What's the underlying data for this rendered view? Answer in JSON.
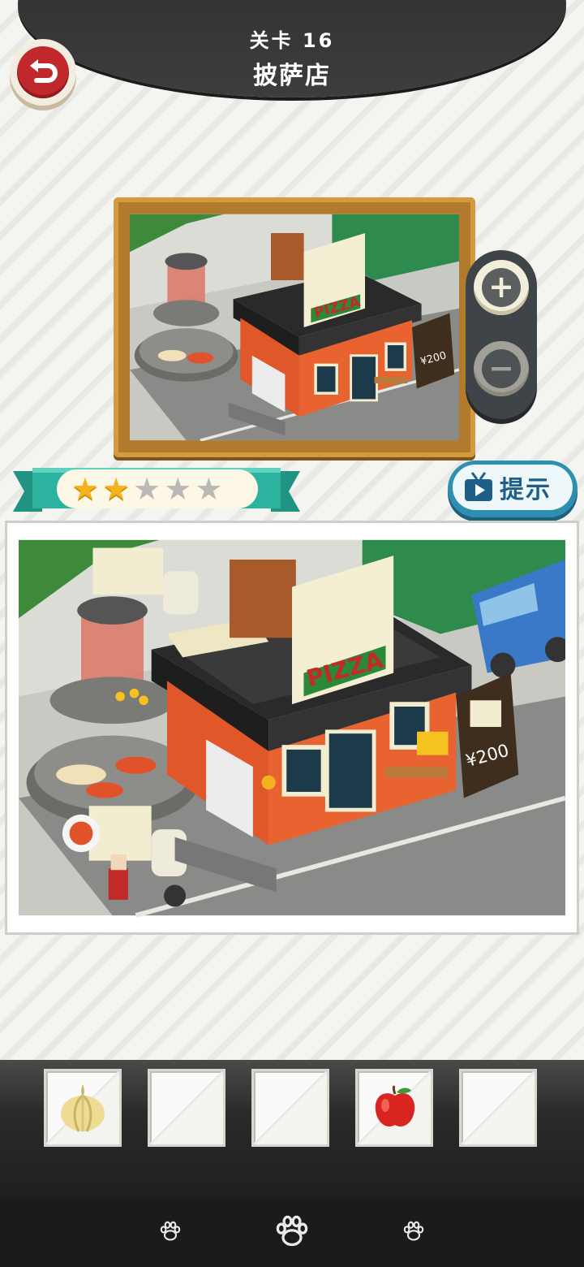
{
  "header": {
    "level_label": "关卡 16",
    "level_title": "披萨店"
  },
  "icons": {
    "back": "back-arrow-icon",
    "zoom_in": "plus-icon",
    "zoom_out": "minus-icon",
    "hint": "tv-play-icon",
    "paw": "paw-icon"
  },
  "rating": {
    "stars_earned": 2,
    "stars_total": 5
  },
  "hint": {
    "label": "提示"
  },
  "scene": {
    "sign_text": "PIZZA",
    "price_text": "¥200"
  },
  "tray": {
    "slots": [
      {
        "item": "garlic"
      },
      {
        "item": ""
      },
      {
        "item": ""
      },
      {
        "item": "apple"
      },
      {
        "item": ""
      }
    ]
  },
  "colors": {
    "banner": "#333333",
    "back_red": "#c0282b",
    "ribbon_teal": "#2bb3a0",
    "star_gold": "#f5b21f",
    "hint_blue": "#2e8fb0",
    "frame_gold": "#b27a2c"
  }
}
